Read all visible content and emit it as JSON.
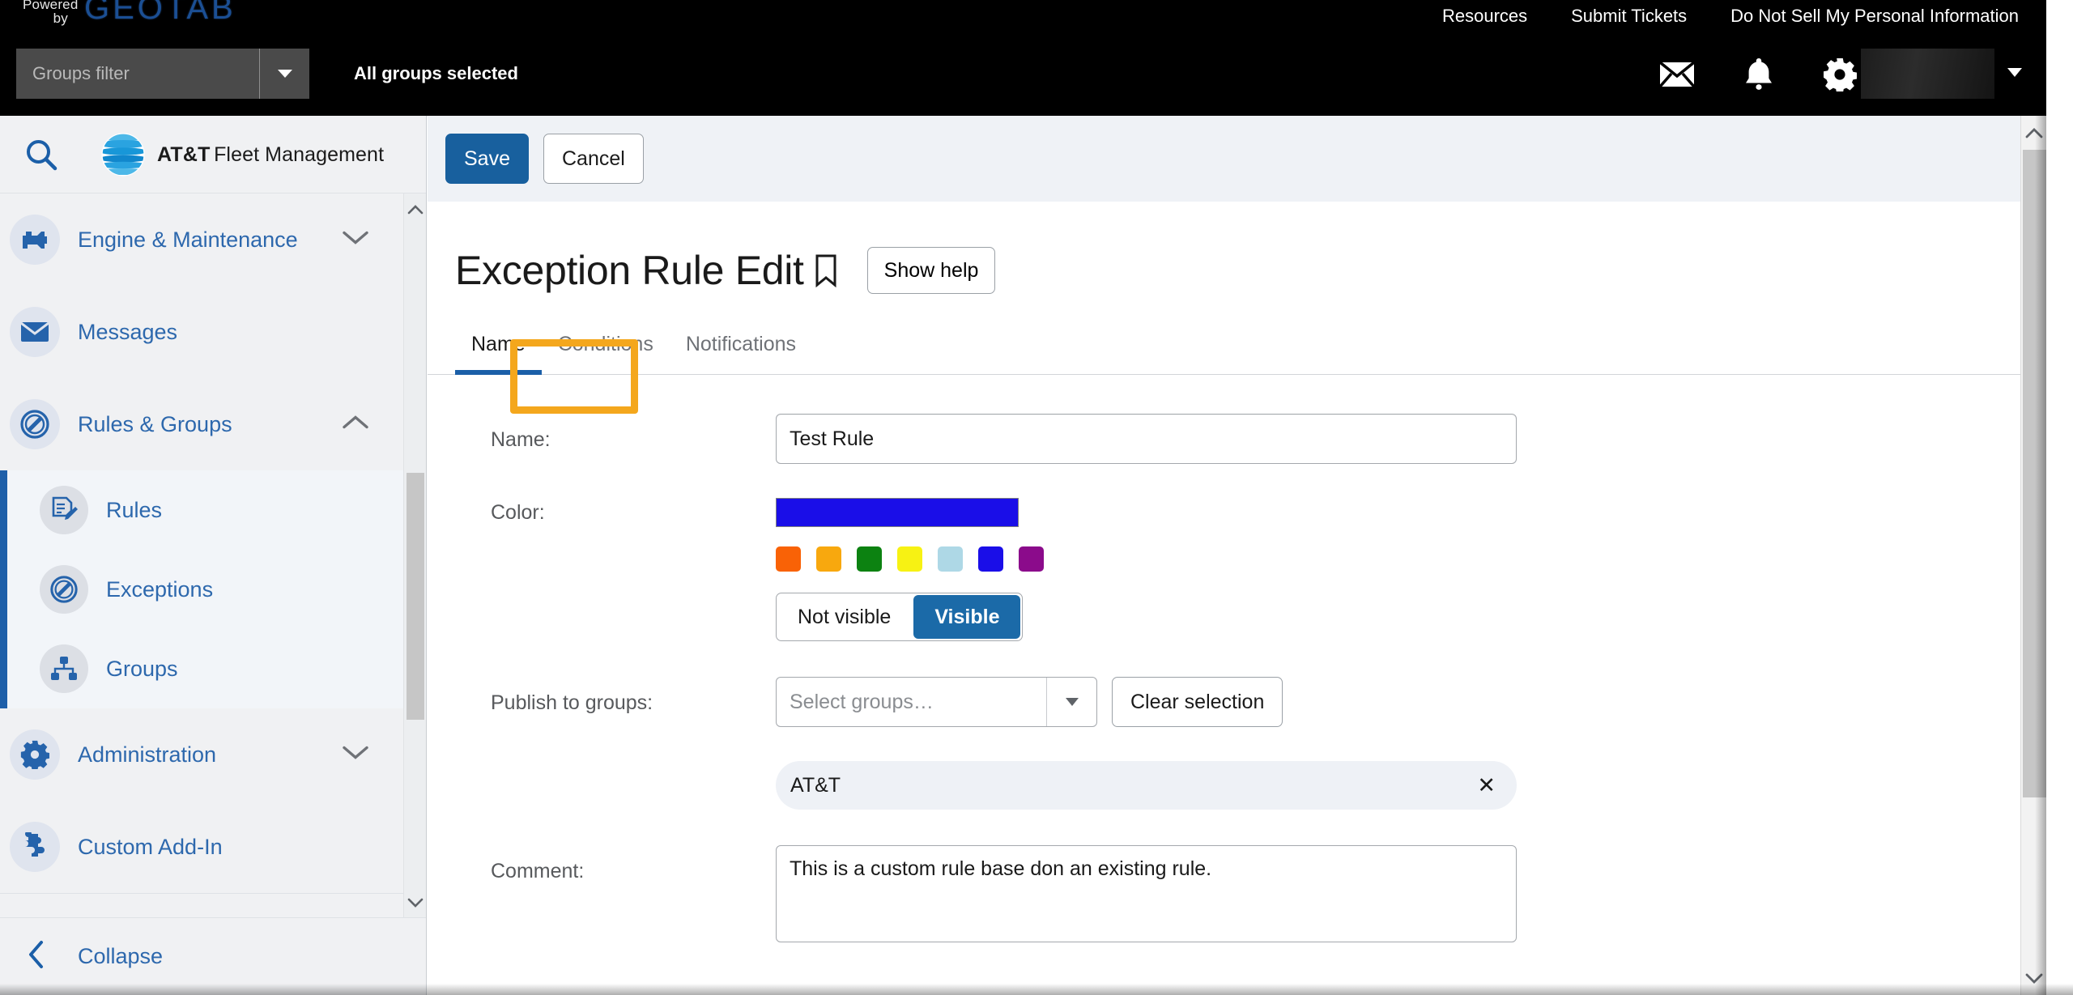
{
  "topbar": {
    "powered_line1": "Powered",
    "powered_line2": "by",
    "brand": "GEOTAB",
    "nav": [
      {
        "label": "Resources"
      },
      {
        "label": "Submit Tickets"
      },
      {
        "label": "Do Not Sell My Personal Information"
      }
    ],
    "groups_filter_placeholder": "Groups filter",
    "all_groups_text": "All groups selected",
    "icons": [
      {
        "name": "mail-icon"
      },
      {
        "name": "bell-icon"
      },
      {
        "name": "gear-icon"
      },
      {
        "name": "user-icon"
      }
    ]
  },
  "sidebar": {
    "brand_line1": "AT&T",
    "brand_line2": "Fleet Management",
    "search_icon": "search-icon",
    "items": [
      {
        "label": "Engine & Maintenance",
        "icon": "engine-icon",
        "expanded": false
      },
      {
        "label": "Messages",
        "icon": "mail-icon",
        "expanded": null
      },
      {
        "label": "Rules & Groups",
        "icon": "prohibited-icon",
        "expanded": true
      }
    ],
    "subitems": [
      {
        "label": "Rules",
        "icon": "document-edit-icon"
      },
      {
        "label": "Exceptions",
        "icon": "prohibited-icon"
      },
      {
        "label": "Groups",
        "icon": "org-chart-icon"
      }
    ],
    "items_after": [
      {
        "label": "Administration",
        "icon": "gear-icon",
        "expanded": false
      },
      {
        "label": "Custom Add-In",
        "icon": "puzzle-icon",
        "expanded": null
      }
    ],
    "collapse_label": "Collapse"
  },
  "main": {
    "actions": {
      "save_label": "Save",
      "cancel_label": "Cancel"
    },
    "page_title": "Exception Rule Edit",
    "bookmark_icon": "bookmark-icon",
    "show_help_label": "Show help",
    "tabs": [
      {
        "label": "Name",
        "active": true
      },
      {
        "label": "Conditions",
        "active": false,
        "highlighted": true
      },
      {
        "label": "Notifications",
        "active": false
      }
    ],
    "form": {
      "name_label": "Name:",
      "name_value": "Test Rule",
      "color_label": "Color:",
      "selected_color": "#1a0ee8",
      "swatches": [
        "#f96206",
        "#f8a80e",
        "#0c8211",
        "#f7f213",
        "#aed8e6",
        "#1a0ee8",
        "#8b0b8b"
      ],
      "visibility_options": [
        {
          "label": "Not visible",
          "selected": false
        },
        {
          "label": "Visible",
          "selected": true
        }
      ],
      "publish_label": "Publish to groups:",
      "select_groups_placeholder": "Select groups…",
      "clear_selection_label": "Clear selection",
      "selected_groups": [
        {
          "label": "AT&T",
          "remove_icon": "close-icon"
        }
      ],
      "comment_label": "Comment:",
      "comment_value": "This is a custom rule base don an existing rule."
    }
  },
  "colors": {
    "accent_blue": "#18609e",
    "highlight_orange": "#f4a71d",
    "sidebar_link": "#2d68ad",
    "topbar_bg": "#000000"
  }
}
